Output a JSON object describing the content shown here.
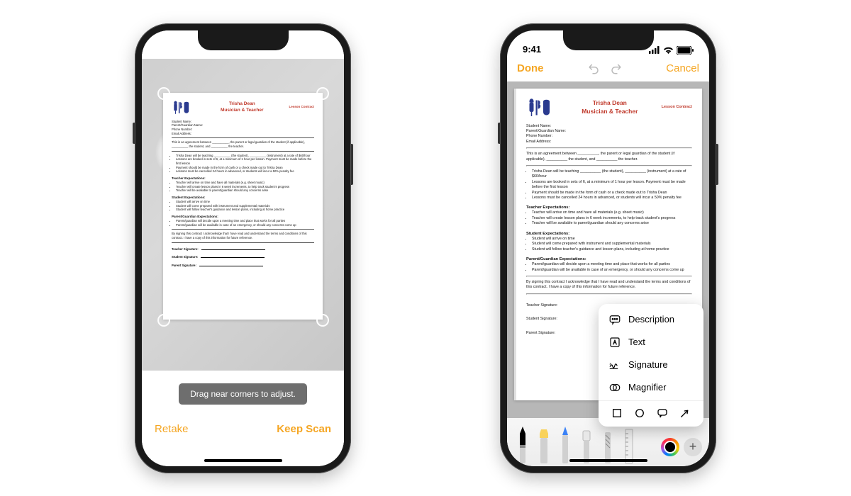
{
  "phone1": {
    "hint": "Drag near corners to adjust.",
    "retake": "Retake",
    "keep": "Keep Scan"
  },
  "phone2": {
    "status_time": "9:41",
    "nav_done": "Done",
    "nav_cancel": "Cancel",
    "popover": {
      "description": "Description",
      "text": "Text",
      "signature": "Signature",
      "magnifier": "Magnifier"
    }
  },
  "document": {
    "title_line1": "Trisha Dean",
    "title_line2": "Musician & Teacher",
    "badge": "Lesson Contract",
    "fields": {
      "student_name": "Student Name:",
      "parent_name": "Parent/Guardian Name:",
      "phone": "Phone Number:",
      "email": "Email Address:"
    },
    "agreement_a": "This is an agreement between __________, the parent or legal guardian of the student (if applicable), __________ the student, and __________ the teacher.",
    "terms": [
      "Trisha Dean will be teaching __________ (the student), __________ (instrument) at a rate of $60/hour",
      "Lessons are booked in sets of 6, at a minimum of 1 hour per lesson. Payment must be made before the first lesson",
      "Payment should be made in the form of cash or a check made out to Trisha Dean",
      "Lessons must be cancelled 24 hours in advanced, or students will incur a 50% penalty fee"
    ],
    "teacher_h": "Teacher Expectations:",
    "teacher": [
      "Teacher will arrive on time and have all materials (e.g. sheet music)",
      "Teacher will create lesson plans in 6 week increments, to help track student's progress",
      "Teacher will be available to parent/guardian should any concerns arise"
    ],
    "student_h": "Student Expectations:",
    "student": [
      "Student will arrive on time",
      "Student will come prepared with instrument and supplemental materials",
      "Student will follow teacher's guidance and lesson plans, including at home practice"
    ],
    "parent_h": "Parent/Guardian Expectations:",
    "parent": [
      "Parent/guardian will decide upon a meeting time and place that works for all parties",
      "Parent/guardian will be available in case of an emergency, or should any concerns come up"
    ],
    "ack": "By signing this contract I acknowledge that I have read and understand the terms and conditions of this contract. I have a copy of this information for future reference.",
    "sig_teacher": "Teacher Signature:",
    "sig_student": "Student Signature:",
    "sig_parent": "Parent Signature:"
  }
}
